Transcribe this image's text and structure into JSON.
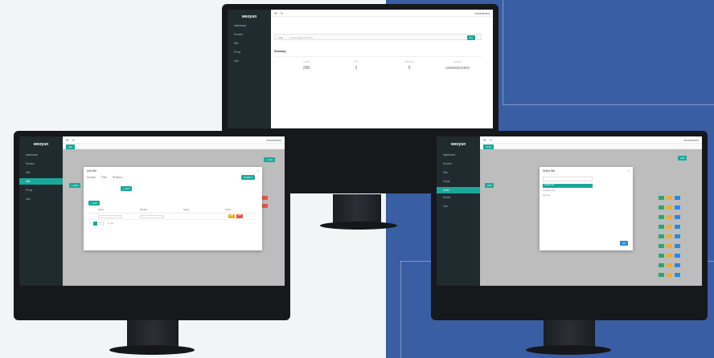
{
  "app": {
    "logo": "weoyun"
  },
  "monitor_top": {
    "sidebar": [
      "dashboard",
      "Servers",
      "Site",
      "Proxy",
      "Link"
    ],
    "topbar_right": "Administrator",
    "path_label": "Path",
    "path_value": "/usr/local/apps/demo/...",
    "go_button": "Go",
    "section_title": "Summary",
    "stats": [
      {
        "label": "Load",
        "value": "258"
      },
      {
        "label": "CPU",
        "value": "2"
      },
      {
        "label": "Memory",
        "value": "0"
      },
      {
        "label": "Uptime",
        "value": "1000/800/4/40%"
      }
    ]
  },
  "monitor_left": {
    "sidebar": [
      "dashboard",
      "Servers",
      "Site",
      "Site",
      "Proxy",
      "Link"
    ],
    "active_index": 3,
    "tab": "Site",
    "topbar_right": "Administrator",
    "dialog_title": "Add Site",
    "dialog_tabs": [
      "Domain",
      "Path",
      "Redirect"
    ],
    "add_button": "+ Add",
    "confirm_button": "Confirm",
    "table_headers": [
      "Name",
      "Domain",
      "Target",
      "Action"
    ],
    "pager": "1 / 10",
    "edit_label": "Edit",
    "delete_label": "Del"
  },
  "monitor_right": {
    "sidebar": [
      "dashboard",
      "Servers",
      "Site",
      "Cloud",
      "Certs",
      "Nodes",
      "Link"
    ],
    "active_index": 4,
    "tab": "Certs",
    "topbar_right": "Administrator",
    "dialog_title": "Select Site",
    "dialog_options": [
      "default.site",
      "example.com",
      "test.site"
    ],
    "dialog_ok": "OK",
    "add_button": "Add"
  },
  "colors": {
    "accent": "#1aa89a",
    "sidebar": "#1f2b2e",
    "blue_bg": "#3a5ea3",
    "warn": "#f0ad2b",
    "danger": "#e4554b",
    "info": "#2b8ad8"
  }
}
